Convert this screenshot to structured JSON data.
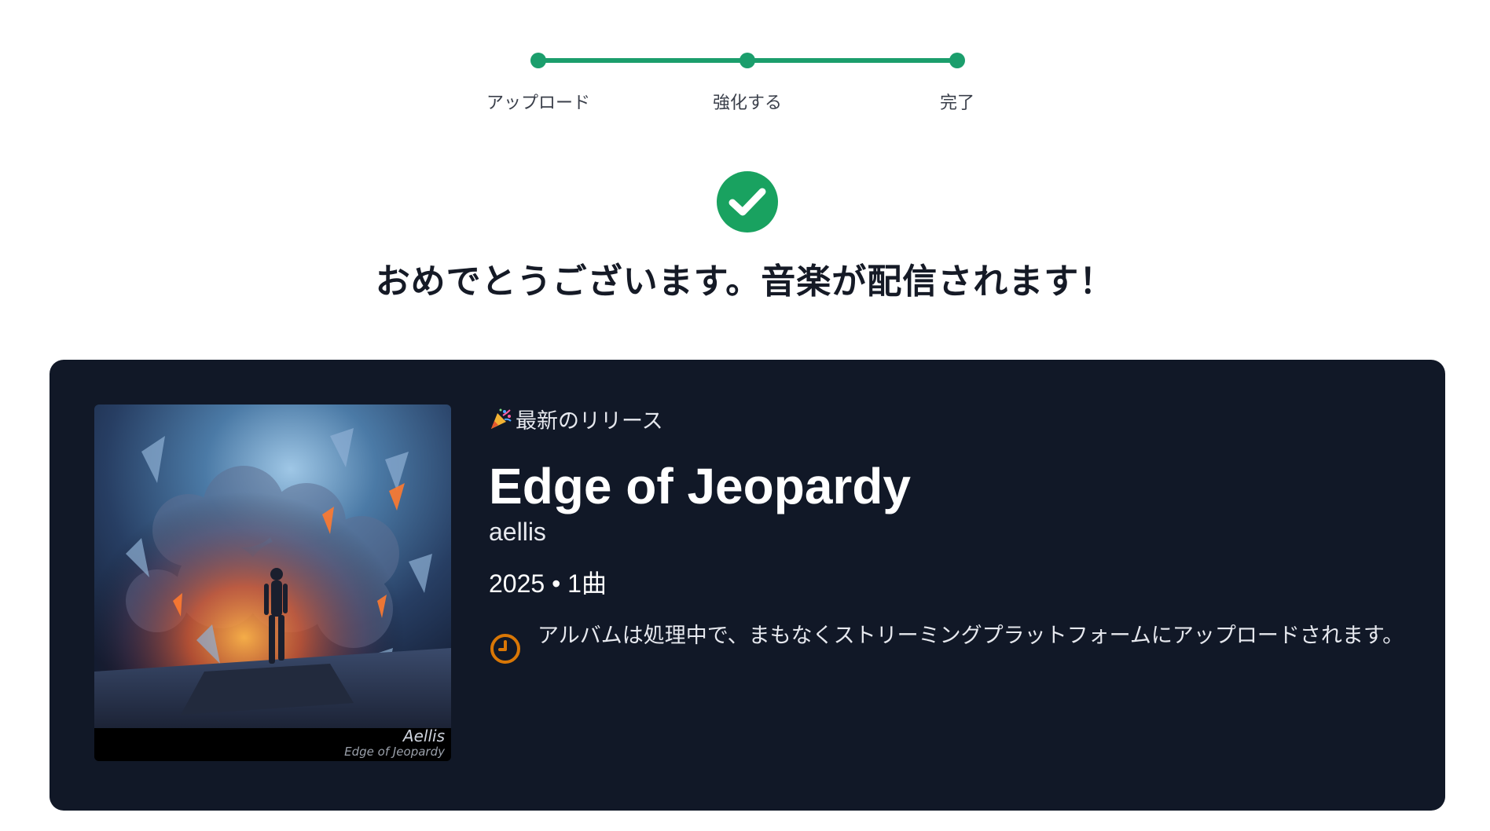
{
  "stepper": {
    "steps": [
      {
        "label": "アップロード"
      },
      {
        "label": "強化する"
      },
      {
        "label": "完了"
      }
    ],
    "accent_color": "#1b9e6c",
    "completed_steps": 3
  },
  "success": {
    "icon": "check-circle-icon",
    "color": "#19a260",
    "headline": "おめでとうございます。音楽が配信されます！"
  },
  "release": {
    "badge_icon": "party-popper-icon",
    "badge_label": "最新のリリース",
    "title": "Edge of Jeopardy",
    "artist": "aellis",
    "meta": "2025 • 1曲",
    "cover": {
      "brand_text": "Aellis",
      "subtitle_text": "Edge of Jeopardy"
    },
    "notice_icon": "clock-icon",
    "notice_color": "#d97706",
    "notice_text": "アルバムは処理中で、まもなくストリーミングプラットフォームにアップロードされます。",
    "card_color": "#111827"
  }
}
